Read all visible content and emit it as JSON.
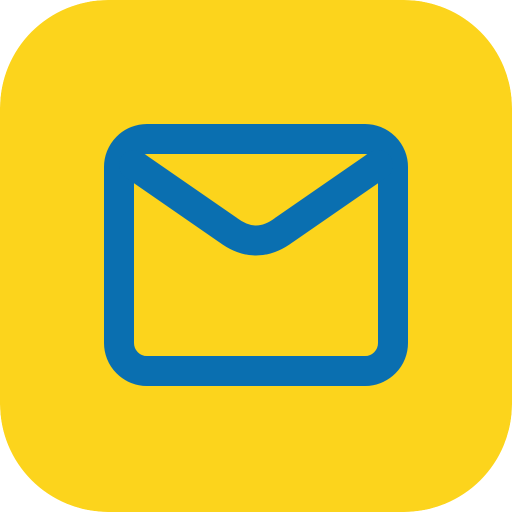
{
  "app_icon": {
    "icon": "mail-envelope-icon",
    "colors": {
      "background": "#FCD41C",
      "envelope_stroke": "#0A6FB0"
    }
  }
}
